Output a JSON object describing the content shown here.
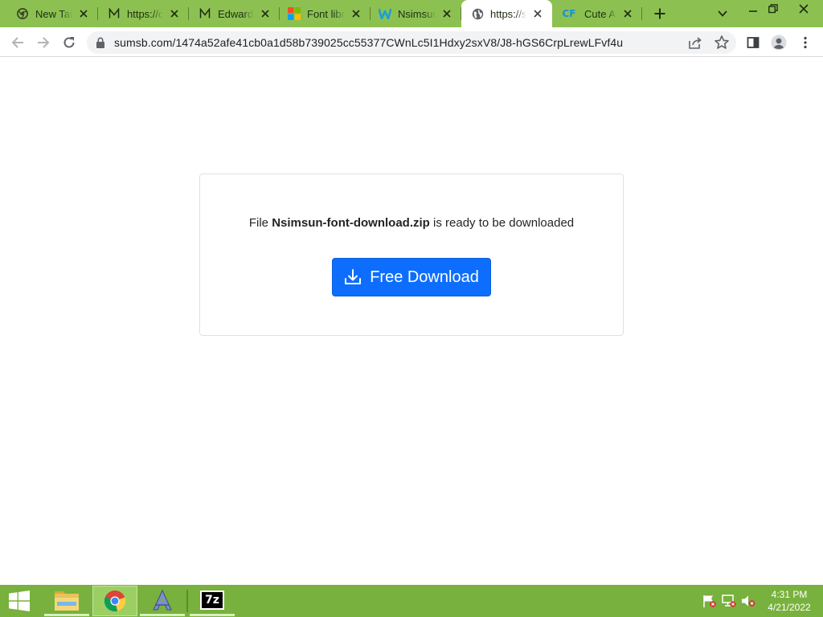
{
  "browser": {
    "tabs": [
      {
        "title": "New Tab",
        "icon": "chrome-icon"
      },
      {
        "title": "https://c",
        "icon": "medium-m-icon"
      },
      {
        "title": "Edwardia",
        "icon": "medium-m-icon"
      },
      {
        "title": "Font libr",
        "icon": "microsoft-icon"
      },
      {
        "title": "Nsimsun",
        "icon": "w-logo-icon"
      },
      {
        "title": "https://s",
        "icon": "globe-icon",
        "active": true
      },
      {
        "title": "Cute Ani",
        "icon": "cf-logo-icon"
      }
    ],
    "cf_logo_text": "CF",
    "url": "sumsb.com/1474a52afe41cb0a1d58b739025cc55377CWnLc5I1Hdxy2sxV8/J8-hGS6CrpLrewLFvf4u"
  },
  "page": {
    "file_prefix": "File",
    "file_name": "Nsimsun-font-download.zip",
    "file_suffix": "is ready to be downloaded",
    "download_label": "Free Download"
  },
  "taskbar": {
    "items": [
      "file-explorer-icon",
      "chrome-icon",
      "font-app-icon",
      "7zip-icon"
    ],
    "sevenzip_text": "7z",
    "time": "4:31 PM",
    "date": "4/21/2022"
  },
  "colors": {
    "titlebar": "#8cc152",
    "taskbar": "#78b13d",
    "primary_button": "#0d6efd"
  }
}
